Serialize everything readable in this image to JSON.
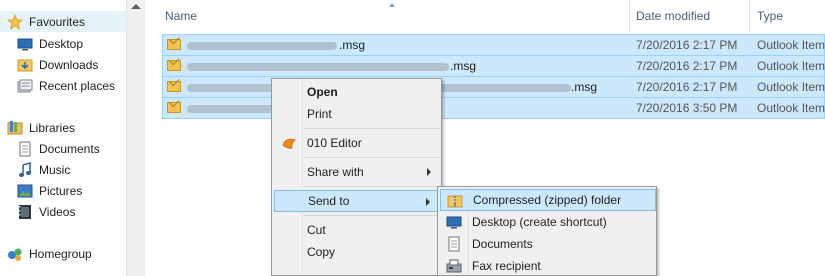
{
  "nav": {
    "favourites": "Favourites",
    "desktop": "Desktop",
    "downloads": "Downloads",
    "recent_places": "Recent places",
    "libraries": "Libraries",
    "documents": "Documents",
    "music": "Music",
    "pictures": "Pictures",
    "videos": "Videos",
    "homegroup": "Homegroup"
  },
  "columns": {
    "name": "Name",
    "date_modified": "Date modified",
    "type": "Type"
  },
  "files": [
    {
      "name_suffix": ".msg",
      "date": "7/20/2016 2:17 PM",
      "type": "Outlook Item"
    },
    {
      "name_suffix": ".msg",
      "date": "7/20/2016 2:17 PM",
      "type": "Outlook Item"
    },
    {
      "name_suffix": ".msg",
      "date": "7/20/2016 2:17 PM",
      "type": "Outlook Item"
    },
    {
      "name_suffix": "",
      "date": "7/20/2016 3:50 PM",
      "type": "Outlook Item"
    }
  ],
  "context_menu": {
    "open": "Open",
    "print": "Print",
    "editor": "010 Editor",
    "share_with": "Share with",
    "send_to": "Send to",
    "cut": "Cut",
    "copy": "Copy"
  },
  "send_to_menu": {
    "compressed": "Compressed (zipped) folder",
    "desktop_shortcut": "Desktop (create shortcut)",
    "documents": "Documents",
    "fax": "Fax recipient"
  },
  "colors": {
    "selection": "#cce8ff",
    "selection_border": "#99d1ff",
    "menu_bg": "#f0f0f0",
    "header_text": "#4c607a"
  }
}
